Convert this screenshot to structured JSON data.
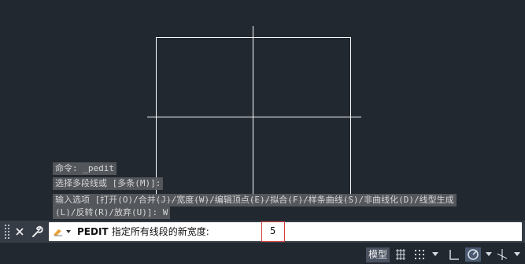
{
  "history": [
    "命令: _pedit",
    "选择多段线或 [多条(M)]:",
    "输入选项 [打开(O)/合并(J)/宽度(W)/编辑顶点(E)/拟合(F)/样条曲线(S)/非曲线化(D)/线型生成",
    "(L)/反转(R)/放弃(U)]: W"
  ],
  "command_line": {
    "prompt_bold": "PEDIT",
    "prompt_text": "指定所有线段的新宽度:",
    "input_value": "5"
  },
  "status_bar": {
    "model_tab": "模型"
  },
  "colors": {
    "canvas_bg": "#212830",
    "geometry": "#ffffff",
    "highlight_border": "#d13b3b"
  },
  "icons": [
    "grip-icon",
    "close-icon",
    "wrench-icon",
    "prompt-icon",
    "grid-icon",
    "snap-icon",
    "ortho-icon",
    "polar-icon",
    "isodraft-icon"
  ]
}
